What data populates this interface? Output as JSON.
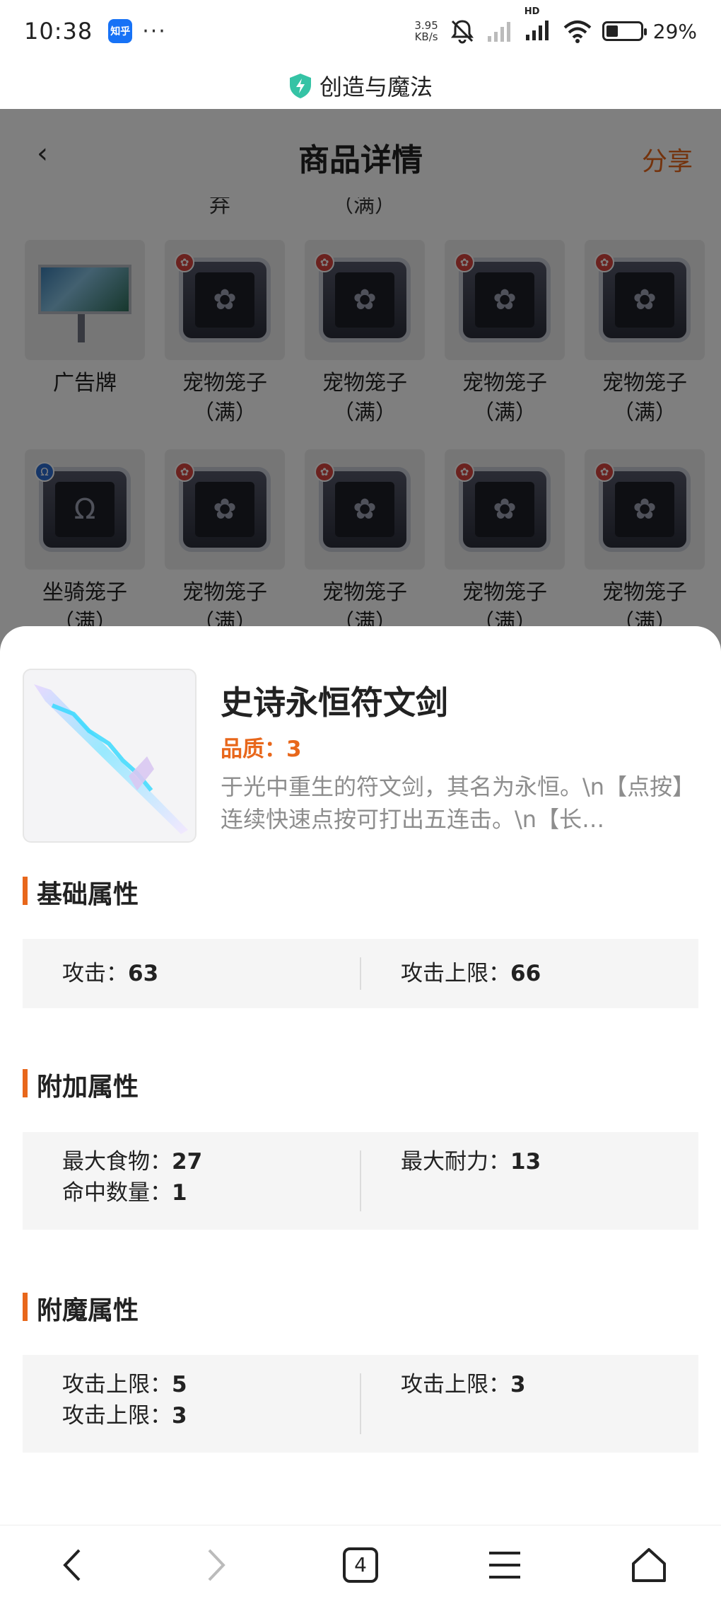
{
  "status_bar": {
    "time": "10:38",
    "app_badge": "知乎",
    "more": "···",
    "net_speed_value": "3.95",
    "net_speed_unit": "KB/s",
    "hd_label": "HD",
    "battery_pct": "29%"
  },
  "browser": {
    "title": "创造与魔法",
    "tab_count": "4"
  },
  "page": {
    "title": "商品详情",
    "share": "分享",
    "clipped_labels": [
      "弃",
      "（满）"
    ],
    "grid": [
      [
        {
          "type": "billboard",
          "label": "广告牌"
        },
        {
          "type": "pet",
          "label": "宠物笼子\n（满）"
        },
        {
          "type": "pet",
          "label": "宠物笼子\n（满）"
        },
        {
          "type": "pet",
          "label": "宠物笼子\n（满）"
        },
        {
          "type": "pet",
          "label": "宠物笼子\n（满）"
        }
      ],
      [
        {
          "type": "mount",
          "label": "坐骑笼子\n（满）"
        },
        {
          "type": "pet",
          "label": "宠物笼子\n（满）"
        },
        {
          "type": "pet",
          "label": "宠物笼子\n（满）"
        },
        {
          "type": "pet",
          "label": "宠物笼子\n（满）"
        },
        {
          "type": "pet",
          "label": "宠物笼子\n（满）"
        }
      ]
    ]
  },
  "item": {
    "name": "史诗永恒符文剑",
    "quality": "品质：3",
    "description": "于光中重生的符文剑，其名为永恒。\\n【点按】连续快速点按可打出五连击。\\n【长…"
  },
  "sections": {
    "basic": {
      "title": "基础属性",
      "left": [
        {
          "label": "攻击：",
          "value": "63"
        }
      ],
      "right": [
        {
          "label": "攻击上限：",
          "value": "66"
        }
      ]
    },
    "extra": {
      "title": "附加属性",
      "left": [
        {
          "label": "最大食物：",
          "value": "27"
        },
        {
          "label": "命中数量：",
          "value": "1"
        }
      ],
      "right": [
        {
          "label": "最大耐力：",
          "value": "13"
        }
      ]
    },
    "enchant": {
      "title": "附魔属性",
      "left": [
        {
          "label": "攻击上限：",
          "value": "5"
        },
        {
          "label": "攻击上限：",
          "value": "3"
        }
      ],
      "right": [
        {
          "label": "攻击上限：",
          "value": "3"
        }
      ]
    }
  },
  "colors": {
    "accent": "#e8671b",
    "zhihu_blue": "#1772f6",
    "shield_green": "#35c3a5"
  },
  "icons": [
    "zhihu-icon",
    "mute-icon",
    "signal-icon",
    "wifi-icon",
    "battery-icon",
    "shield-icon",
    "back-icon",
    "forward-icon",
    "tabs-icon",
    "menu-icon",
    "home-icon",
    "paw-icon",
    "horseshoe-icon"
  ]
}
